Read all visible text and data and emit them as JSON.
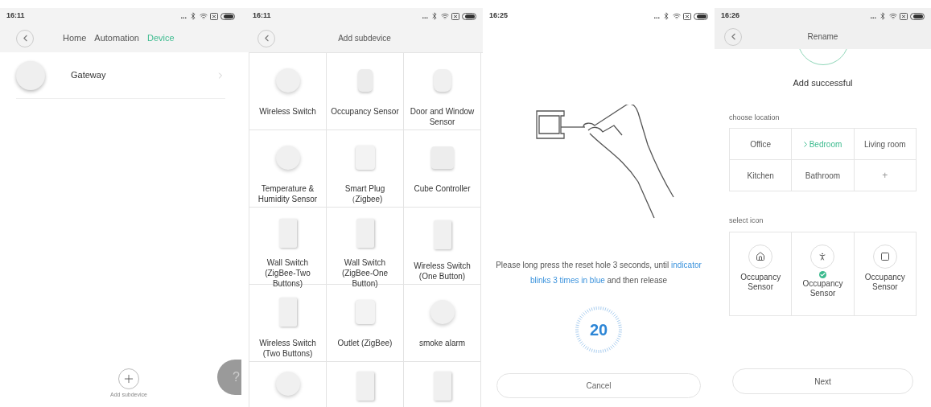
{
  "device_list_screen": {
    "status_bar": {
      "time": "16:11",
      "more": "..."
    },
    "tabs": [
      {
        "label": "Home",
        "selected": false
      },
      {
        "label": "Automation",
        "selected": false
      },
      {
        "label": "Device",
        "selected": true
      }
    ],
    "devices": [
      {
        "name": "Gateway"
      }
    ],
    "add_button": {
      "label": "Add subdevice"
    },
    "help_button": {
      "label": "?"
    }
  },
  "add_subdevice_screen": {
    "status_bar": {
      "time": "16:11",
      "more": "..."
    },
    "title": "Add subdevice",
    "devices": [
      {
        "name": "Wireless Switch",
        "kind": "round"
      },
      {
        "name": "Occupancy Sensor",
        "kind": "cylinder"
      },
      {
        "name": "Door and Window Sensor",
        "kind": "pair"
      },
      {
        "name": "Temperature & Humidity Sensor",
        "kind": "round"
      },
      {
        "name": "Smart Plug（Zigbee)",
        "kind": "plug"
      },
      {
        "name": "Cube Controller",
        "kind": "cube"
      },
      {
        "name": "Wall Switch (ZigBee-Two Buttons)",
        "kind": "panel"
      },
      {
        "name": "Wall Switch (ZigBee-One Button)",
        "kind": "panel"
      },
      {
        "name": "Wireless Switch (One Button)",
        "kind": "panel"
      },
      {
        "name": "Wireless Switch (Two Buttons)",
        "kind": "panel"
      },
      {
        "name": "Outlet (ZigBee)",
        "kind": "plug"
      },
      {
        "name": "smoke alarm",
        "kind": "round"
      }
    ]
  },
  "reset_screen": {
    "status_bar": {
      "time": "16:25",
      "more": "..."
    },
    "instruction": [
      {
        "text": "Please long press the reset hole  3 seconds, until ",
        "highlight": false
      },
      {
        "text": "indicator blinks 3 times in blue",
        "highlight": true
      },
      {
        "text": "  and then release",
        "highlight": false
      }
    ],
    "countdown": {
      "value": "20"
    },
    "cancel_button": "Cancel"
  },
  "rename_screen": {
    "status_bar": {
      "time": "16:26",
      "more": "..."
    },
    "title": "Rename",
    "message": "Add successful",
    "location_label": "choose location",
    "locations": [
      {
        "label": "Office",
        "selected": false
      },
      {
        "label": "Bedroom",
        "selected": true
      },
      {
        "label": "Living room",
        "selected": false
      },
      {
        "label": "Kitchen",
        "selected": false
      },
      {
        "label": "Bathroom",
        "selected": false
      }
    ],
    "add_location": "+",
    "icon_label": "select icon",
    "icons": [
      {
        "label": "Occupancy Sensor",
        "kind": "house",
        "selected": false
      },
      {
        "label": "Occupancy Sensor",
        "kind": "walker",
        "selected": true
      },
      {
        "label": "Occupancy Sensor",
        "kind": "panel",
        "selected": false
      }
    ],
    "next_button": "Next"
  }
}
